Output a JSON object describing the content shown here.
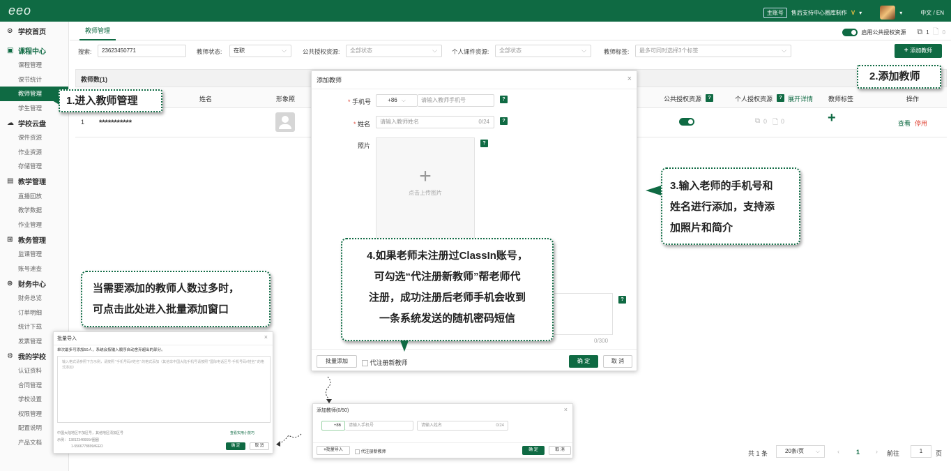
{
  "topbar": {
    "logo": "eeo",
    "account_tag": "主账号",
    "school": "售后支持中心圈库制作",
    "vip": "V",
    "lang": "中文 / EN"
  },
  "sidebar": {
    "sections": [
      {
        "label": "学校首页",
        "icon": "home-icon"
      },
      {
        "label": "课程中心",
        "icon": "calendar-icon",
        "items": [
          "课程管理",
          "课节统计",
          "教师管理",
          "学生管理"
        ]
      },
      {
        "label": "学校云盘",
        "icon": "cloud-icon",
        "items": [
          "课件资源",
          "作业资源",
          "存储管理"
        ]
      },
      {
        "label": "教学管理",
        "icon": "monitor-icon",
        "items": [
          "直播回放",
          "教学数据",
          "作业管理"
        ]
      },
      {
        "label": "教务管理",
        "icon": "grid-icon",
        "items": [
          "监课管理",
          "账号速查"
        ]
      },
      {
        "label": "财务中心",
        "icon": "money-icon",
        "items": [
          "财务总览",
          "订单明细",
          "统计下载",
          "发票管理"
        ]
      },
      {
        "label": "我的学校",
        "icon": "gear-icon",
        "items": [
          "认证资料",
          "合同管理",
          "学校设置",
          "权限管理",
          "配置说明",
          "产品文档"
        ]
      }
    ]
  },
  "main": {
    "tab": "教师管理",
    "public_toggle_label": "启用公共授权资源",
    "count_1": "1",
    "count_2": "0",
    "filters": {
      "search_label": "搜索:",
      "search_value": "23623450771",
      "status_label": "教师状态:",
      "status_value": "在职",
      "public_label": "公共授权资源:",
      "public_placeholder": "全部状态",
      "personal_label": "个人课件资源:",
      "personal_placeholder": "全部状态",
      "tag_label": "教师标签:",
      "tag_placeholder": "最多可同时选择3个标签"
    },
    "add_button": "添加教师",
    "table": {
      "count_label": "教师数(1)",
      "headers": {
        "name": "姓名",
        "photo": "形象照",
        "public": "公共授权资源",
        "personal": "个人授权资源",
        "expand": "展开详情",
        "tags": "教师标签",
        "ops": "操作"
      },
      "row": {
        "index": "1",
        "name": "***********",
        "pub_count": "0",
        "priv_count": "0",
        "plus": "+",
        "view": "查看",
        "stop": "停用"
      }
    },
    "pagination": {
      "total": "共 1 条",
      "per_page": "20条/页",
      "current": "1",
      "goto_label": "前往",
      "goto_value": "1",
      "page_suffix": "页"
    }
  },
  "add_modal": {
    "title": "添加教师",
    "phone_label": "手机号",
    "country_code": "+86",
    "phone_placeholder": "请输入教师手机号",
    "name_label": "姓名",
    "name_placeholder": "请输入教师姓名",
    "name_counter": "0/24",
    "photo_label": "照片",
    "upload_text": "点击上传图片",
    "intro_counter": "0/300",
    "batch_button": "批量添加",
    "register_label": "代注册新教师",
    "confirm": "确 定",
    "cancel": "取 消"
  },
  "batch_modal": {
    "title": "批量导入",
    "notice": "单次最多可添加50人，系统会按输入顺序自动舍弃超出的部分。",
    "placeholder": "输入格式请参照下方示例，请按照 \"手机号码#姓名\" 的格式添加（其他非中国大陆手机号请按照 \"国际电话区号-手机号码#姓名\" 的格式添加）",
    "hint1": "中国大陆地区不加区号，其他地区须加区号",
    "tip_link": "查看实用小技巧",
    "hint2": "示例：  13812346666#圈圈",
    "hint3": "1-5566778899#EEO",
    "confirm": "确 定",
    "cancel": "取 消"
  },
  "mini_modal": {
    "title": "添加教师(0/50)",
    "country_code": "+86",
    "phone_placeholder": "请输入手机号",
    "name_placeholder": "请输入姓名",
    "counter": "0/24",
    "batch_button": "批量导入",
    "register_label": "代注册新教师",
    "confirm": "确 定",
    "cancel": "取 消"
  },
  "callouts": {
    "c1": "1.进入教师管理",
    "c2": "2.添加教师",
    "c3": [
      "3.输入老师的手机号和",
      "姓名进行添加，支持添",
      "加照片和简介"
    ],
    "c4": [
      "4.如果老师未注册过ClassIn账号，",
      "可勾选“代注册新教师”帮老师代",
      "注册，成功注册后老师手机会收到",
      "一条系统发送的随机密码短信"
    ],
    "c5": [
      "当需要添加的教师人数过多时，",
      "可点击此处进入批量添加窗口"
    ]
  },
  "colors": {
    "brand": "#0f6a43",
    "danger": "#e04b3c"
  }
}
